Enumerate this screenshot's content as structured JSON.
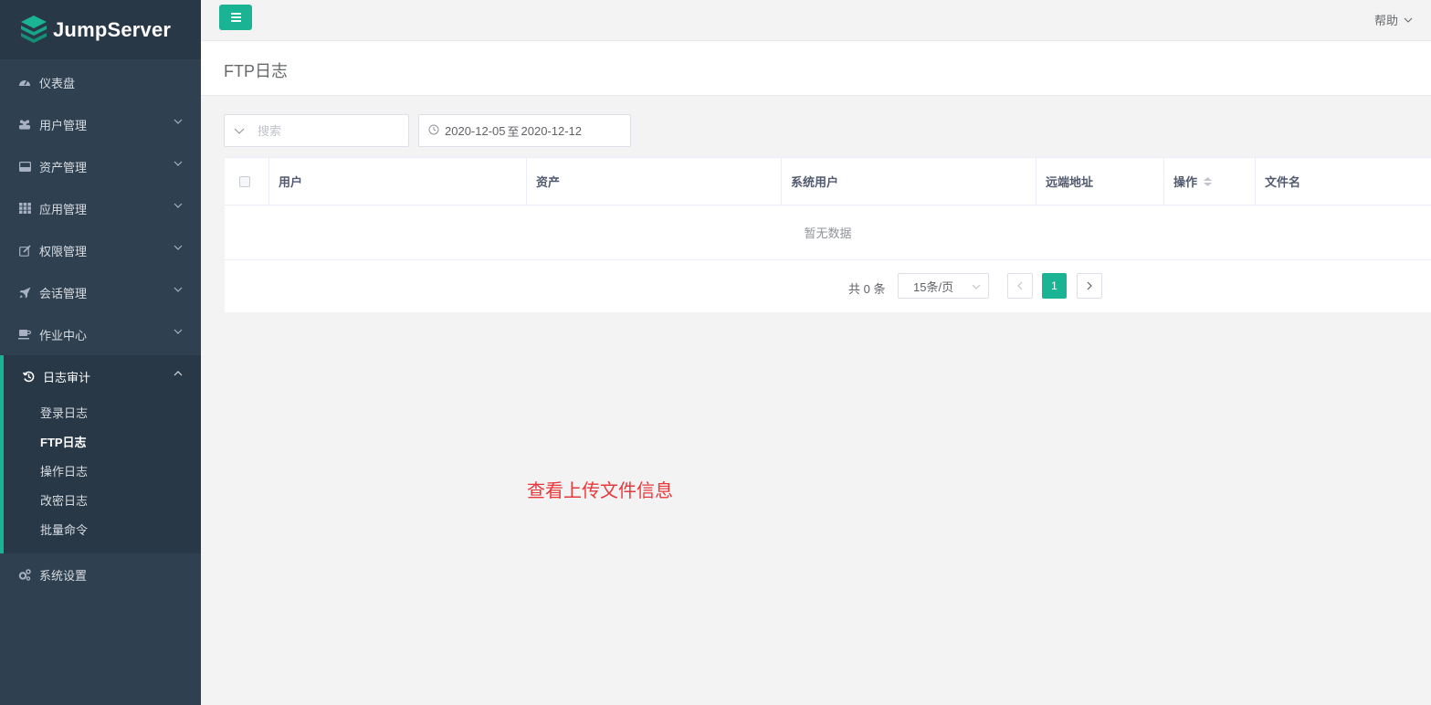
{
  "app": {
    "brand": "JumpServer"
  },
  "sidebar": {
    "items": [
      {
        "label": "仪表盘",
        "icon": "dashboard-icon"
      },
      {
        "label": "用户管理",
        "icon": "users-icon"
      },
      {
        "label": "资产管理",
        "icon": "inbox-icon"
      },
      {
        "label": "应用管理",
        "icon": "grid-icon"
      },
      {
        "label": "权限管理",
        "icon": "edit-icon"
      },
      {
        "label": "会话管理",
        "icon": "rocket-icon"
      },
      {
        "label": "作业中心",
        "icon": "coffee-icon"
      }
    ],
    "audit": {
      "label": "日志审计",
      "icon": "history-icon",
      "children": [
        "登录日志",
        "FTP日志",
        "操作日志",
        "改密日志",
        "批量命令"
      ]
    },
    "settings": {
      "label": "系统设置",
      "icon": "cogs-icon"
    }
  },
  "topbar": {
    "help": "帮助"
  },
  "page": {
    "title": "FTP日志"
  },
  "filters": {
    "search_placeholder": "搜索",
    "date_start": "2020-12-05",
    "date_sep": "至",
    "date_end": "2020-12-12"
  },
  "table": {
    "columns": [
      "用户",
      "资产",
      "系统用户",
      "远端地址",
      "操作",
      "文件名"
    ],
    "empty_text": "暂无数据"
  },
  "pagination": {
    "total_prefix": "共",
    "total": "0",
    "total_suffix": "条",
    "page_size": "15条/页",
    "current_page": "1"
  },
  "annotation": "查看上传文件信息",
  "colors": {
    "accent": "#1ab394",
    "sidebar": "#2f4050",
    "annotation": "#e8383b"
  }
}
